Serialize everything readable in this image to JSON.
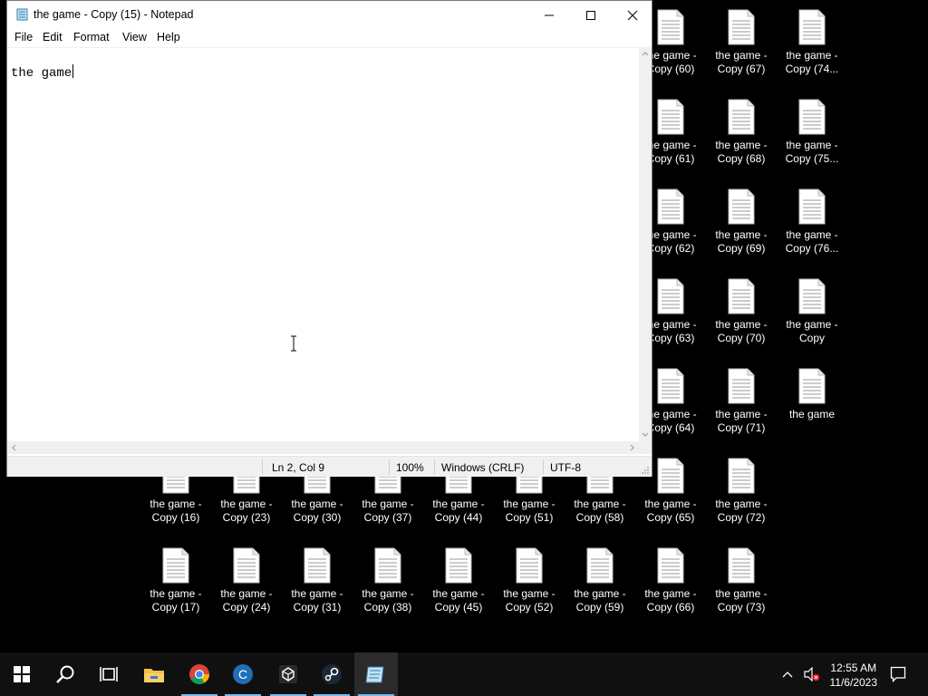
{
  "window": {
    "title": "the game - Copy (15) - Notepad",
    "menu": [
      "File",
      "Edit",
      "Format",
      "View",
      "Help"
    ],
    "content": "the game",
    "status": {
      "position": "Ln 2, Col 9",
      "zoom": "100%",
      "line_ending": "Windows (CRLF)",
      "encoding": "UTF-8"
    }
  },
  "desktop_icons": {
    "col_a": [
      "the game -\nCopy (60)",
      "the game -\nCopy (61)",
      "the game -\nCopy (62)",
      "the game -\nCopy (63)",
      "the game -\nCopy (64)",
      "the game -\nCopy (65)",
      "the game -\nCopy (66)"
    ],
    "col_b": [
      "the game -\nCopy (67)",
      "the game -\nCopy (68)",
      "the game -\nCopy (69)",
      "the game -\nCopy (70)",
      "the game -\nCopy (71)",
      "the game -\nCopy (72)",
      "the game -\nCopy (73)"
    ],
    "col_c": [
      "the game -\nCopy (74...",
      "the game -\nCopy (75...",
      "the game -\nCopy (76...",
      "the game -\nCopy",
      "the game"
    ],
    "row_1": [
      "the game -\nCopy (16)",
      "the game -\nCopy (23)",
      "the game -\nCopy (30)",
      "the game -\nCopy (37)",
      "the game -\nCopy (44)",
      "the game -\nCopy (51)",
      "the game -\nCopy (58)"
    ],
    "row_2": [
      "the game -\nCopy (17)",
      "the game -\nCopy (24)",
      "the game -\nCopy (31)",
      "the game -\nCopy (38)",
      "the game -\nCopy (45)",
      "the game -\nCopy (52)",
      "the game -\nCopy (59)"
    ]
  },
  "taskbar": {
    "apps": [
      "start-icon",
      "search-icon",
      "task-view-icon",
      "file-explorer-icon",
      "chrome-icon",
      "c-app-icon",
      "unity-icon",
      "steam-icon",
      "notepad-icon"
    ],
    "time": "12:55 AM",
    "date": "11/6/2023"
  },
  "colors": {
    "taskbar_bg": "#101010",
    "active_indicator": "#76b9ed",
    "chrome_red": "#db4437",
    "chrome_green": "#0f9d58",
    "chrome_yellow": "#f4b400",
    "c_app_blue": "#1f6fb8",
    "explorer_yellow": "#f5c243"
  }
}
